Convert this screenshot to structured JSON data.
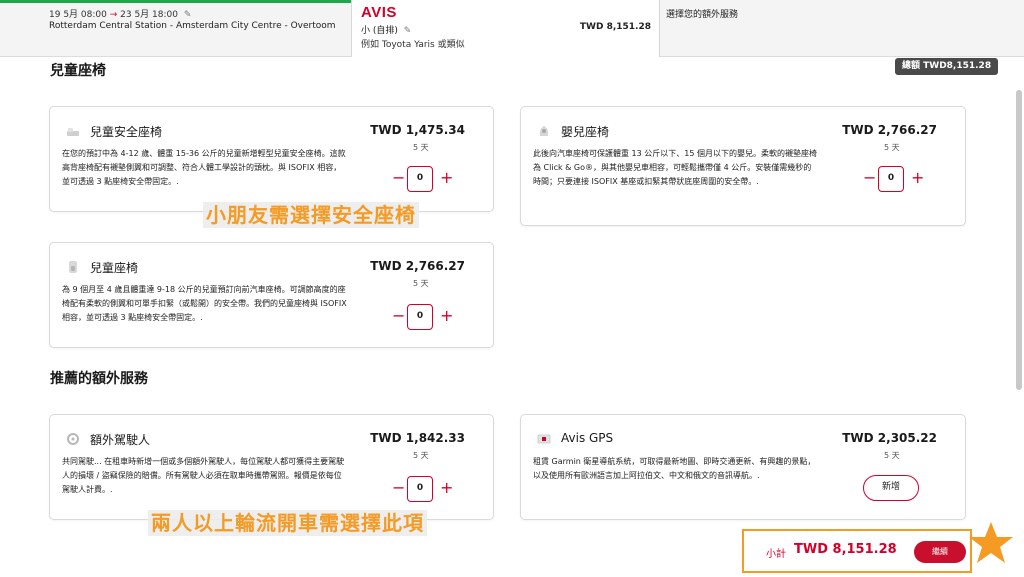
{
  "topbar": {
    "date_start": "19 5月 08:00",
    "date_arrow": "→",
    "date_end": "23 5月 18:00",
    "route": "Rotterdam Central Station - Amsterdam City Centre - Overtoom",
    "brand": "AVIS",
    "car_class": "小 (自排)",
    "car_example": "例如 Toyota Yaris 或類似",
    "total": "TWD 8,151.28",
    "step_title": "選擇您的額外服務",
    "accent_color": "#d4002a",
    "progress_color": "#1fa84a"
  },
  "total_badge": "總額 TWD8,151.28",
  "sections": {
    "child_seats_title": "兒童座椅",
    "recommended_title": "推薦的額外服務"
  },
  "cards": [
    {
      "name": "兒童安全座椅",
      "price": "TWD 1,475.34",
      "days": "5 天",
      "description": "在您的預訂中為 4-12 歲、體重 15-36 公斤的兒童新增輕型兒童安全座椅。這款高背座椅配有襯墊側翼和可調整、符合人體工學設計的頭枕。與 ISOFIX 相容，並可透過 3 點座椅安全帶固定。.",
      "qty": "0",
      "icon": "booster-seat-icon"
    },
    {
      "name": "嬰兒座椅",
      "price": "TWD 2,766.27",
      "days": "5 天",
      "description": "此後向汽車座椅可保護體重 13 公斤以下、15 個月以下的嬰兒。柔軟的襯墊座椅為 Click & Go®，與其他嬰兒車相容，可輕鬆攜帶僅 4 公斤。安裝僅需幾秒的時間；只要連接 ISOFIX 基座或扣緊其帶狀底座周圍的安全帶。.",
      "qty": "0",
      "icon": "infant-seat-icon"
    },
    {
      "name": "兒童座椅",
      "price": "TWD 2,766.27",
      "days": "5 天",
      "description": "為 9 個月至 4 歲且體重達 9-18 公斤的兒童預訂向前汽車座椅。可調節高度的座椅配有柔軟的側翼和可單手扣緊（或鬆開）的安全帶。我們的兒童座椅與 ISOFIX 相容，並可透過 3 點座椅安全帶固定。.",
      "qty": "0",
      "icon": "child-seat-icon"
    },
    {
      "name": "額外駕駛人",
      "price": "TWD 1,842.33",
      "days": "5 天",
      "description": "共同駕駛... 在租車時新增一個或多個額外駕駛人，每位駕駛人都可獲得主要駕駛人的損壞 / 盜竊保險的賠償。所有駕駛人必須在取車時攜帶駕照。報價是依每位駕駛人計費。.",
      "qty": "0",
      "icon": "additional-driver-icon"
    },
    {
      "name": "Avis GPS",
      "price": "TWD 2,305.22",
      "days": "5 天",
      "description": "租賃 Garmin 衛星導航系統，可取得最新地圖、即時交通更新、有興趣的景點，以及使用所有歐洲語言加上阿拉伯文、中文和俄文的音訊導航。.",
      "add_label": "新增",
      "icon": "gps-icon"
    }
  ],
  "annotations": {
    "child_seat_note": "小朋友需選擇安全座椅",
    "driver_note": "兩人以上輪流開車需選擇此項",
    "highlight_color": "#f59a23"
  },
  "footer": {
    "subtotal_label": "小計",
    "subtotal_value": "TWD 8,151.28",
    "continue_label": "繼續"
  }
}
